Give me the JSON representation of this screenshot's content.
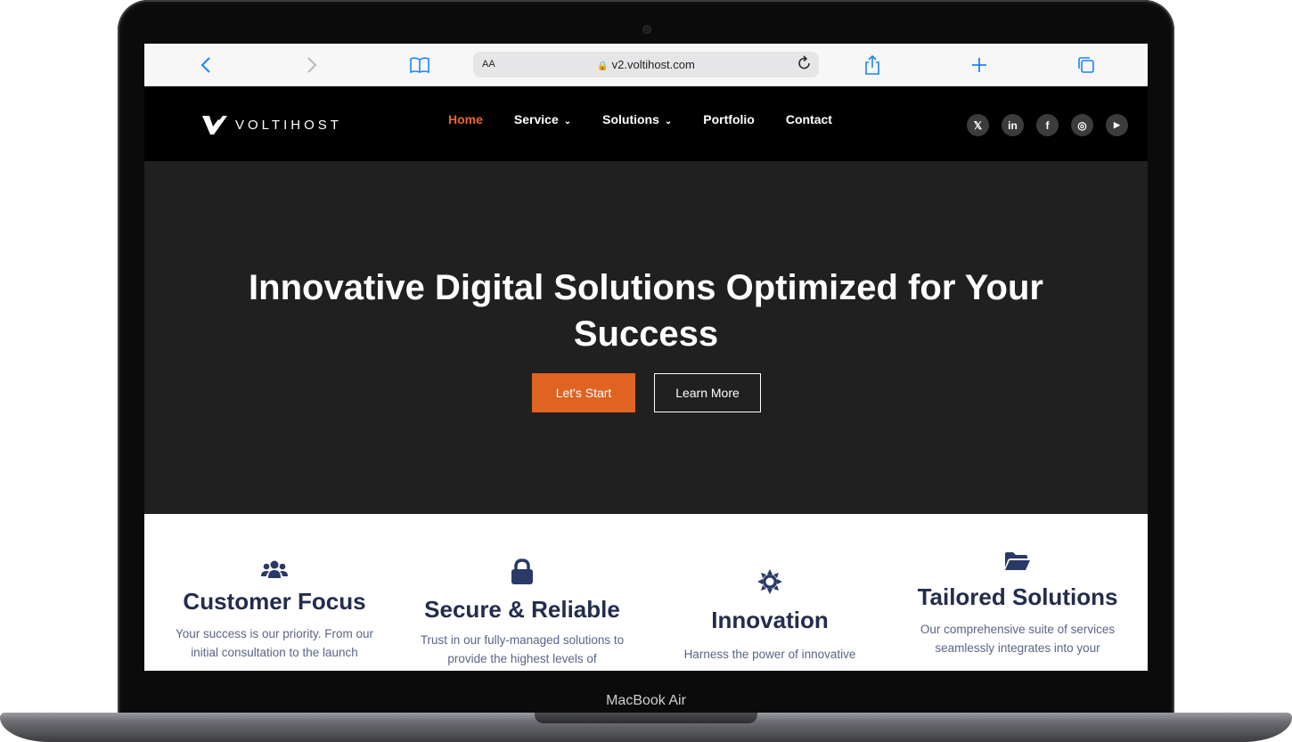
{
  "device": {
    "model_label": "MacBook Air"
  },
  "browser": {
    "back_icon": "chevron-left-icon",
    "forward_icon": "chevron-right-icon",
    "bookmarks_icon": "book-icon",
    "reader_label": "AA",
    "url": "v2.voltihost.com",
    "reload_icon": "reload-icon",
    "share_icon": "share-icon",
    "new_tab_icon": "plus-icon",
    "tabs_icon": "tabs-icon"
  },
  "site": {
    "logo_text": "VOLTIHOST",
    "nav": [
      {
        "label": "Home",
        "active": true,
        "dropdown": false
      },
      {
        "label": "Service",
        "active": false,
        "dropdown": true
      },
      {
        "label": "Solutions",
        "active": false,
        "dropdown": true
      },
      {
        "label": "Portfolio",
        "active": false,
        "dropdown": false
      },
      {
        "label": "Contact",
        "active": false,
        "dropdown": false
      }
    ],
    "socials": [
      {
        "name": "x-icon",
        "glyph": "𝕏"
      },
      {
        "name": "linkedin-icon",
        "glyph": "in"
      },
      {
        "name": "facebook-icon",
        "glyph": "f"
      },
      {
        "name": "instagram-icon",
        "glyph": "◎"
      },
      {
        "name": "youtube-icon",
        "glyph": "▶"
      }
    ],
    "hero": {
      "title": "Innovative Digital Solutions Optimized for Your Success",
      "primary_cta": "Let's Start",
      "secondary_cta": "Learn More"
    },
    "features": [
      {
        "icon": "users-icon",
        "title": "Customer Focus",
        "text": "Your success is our priority. From our initial consultation to the launch"
      },
      {
        "icon": "lock-icon",
        "title": "Secure & Reliable",
        "text": "Trust in our fully-managed solutions to provide the highest levels of"
      },
      {
        "icon": "gear-icon",
        "title": "Innovation",
        "text": "Harness the power of innovative"
      },
      {
        "icon": "folder-open-icon",
        "title": "Tailored Solutions",
        "text": "Our comprehensive suite of services seamlessly integrates into your"
      }
    ]
  },
  "colors": {
    "accent": "#e06321",
    "header_bg": "#000000",
    "hero_bg": "#202020",
    "feature_title": "#222d4d",
    "browser_blue": "#1a84ff"
  }
}
